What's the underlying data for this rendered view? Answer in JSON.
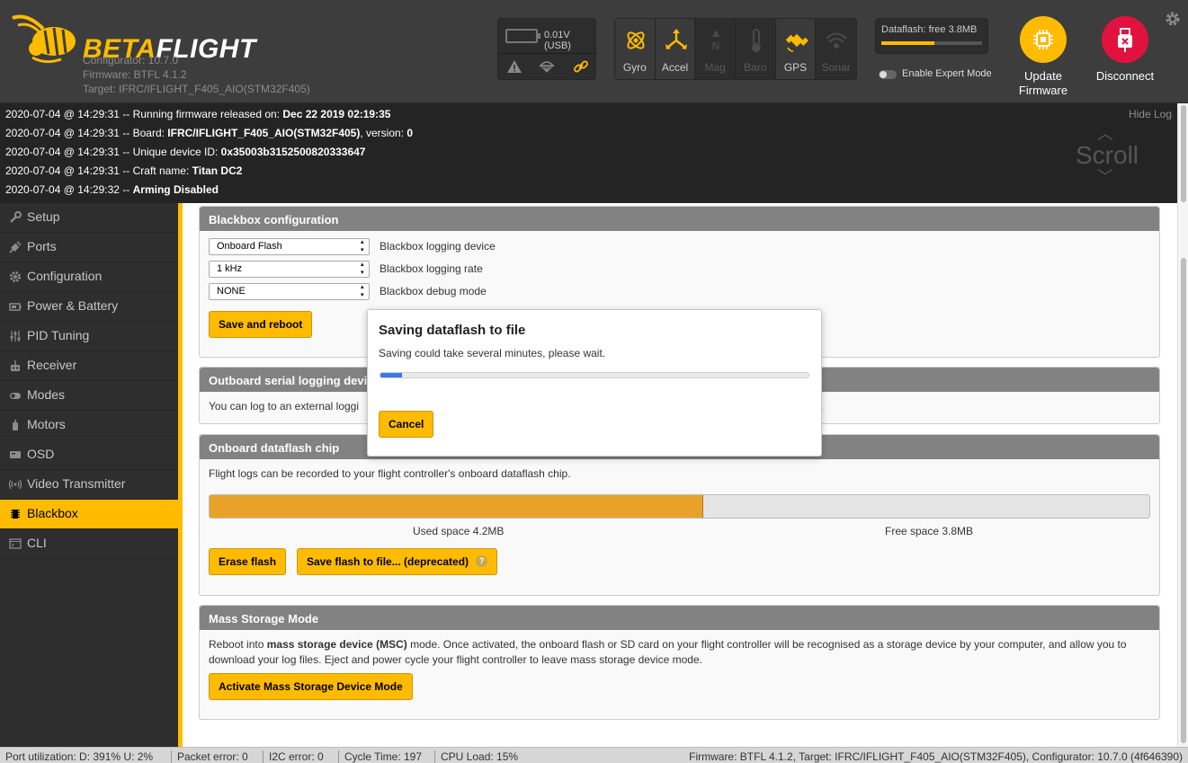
{
  "header": {
    "brand_part1": "BETA",
    "brand_part2": "FLIGHT",
    "configurator": "Configurator: 10.7.0",
    "firmware": "Firmware: BTFL 4.1.2",
    "target": "Target: IFRC/IFLIGHT_F405_AIO(STM32F405)",
    "voltage": "0.01V (USB)",
    "status_icons": [
      "warning-icon",
      "parachute-icon",
      "link-icon"
    ],
    "sensors": [
      {
        "label": "Gyro",
        "icon": "gyro-icon",
        "active": true
      },
      {
        "label": "Accel",
        "icon": "accel-icon",
        "active": true
      },
      {
        "label": "Mag",
        "icon": "mag-icon",
        "active": false
      },
      {
        "label": "Baro",
        "icon": "baro-icon",
        "active": false
      },
      {
        "label": "GPS",
        "icon": "gps-icon",
        "active": true
      },
      {
        "label": "Sonar",
        "icon": "sonar-icon",
        "active": false
      }
    ],
    "dataflash_label": "Dataflash: free 3.8MB",
    "dataflash_used_fraction": 0.53,
    "expert_mode_label": "Enable Expert Mode",
    "expert_mode_on": false,
    "update_firmware_line1": "Update",
    "update_firmware_line2": "Firmware",
    "disconnect_label": "Disconnect",
    "colors": {
      "accent": "#ffbb00",
      "disconnect": "#e2123f",
      "header_bg": "#3d3d3d"
    }
  },
  "log": {
    "hide_label": "Hide Log",
    "scroll_label": "Scroll",
    "lines": [
      {
        "prefix": "2020-07-04 @ 14:29:31 -- Running firmware released on: ",
        "bold": "Dec 22 2019 02:19:35",
        "suffix": ""
      },
      {
        "prefix": "2020-07-04 @ 14:29:31 -- Board: ",
        "bold": "IFRC/IFLIGHT_F405_AIO(STM32F405)",
        "suffix": ", version: ",
        "bold2": "0"
      },
      {
        "prefix": "2020-07-04 @ 14:29:31 -- Unique device ID: ",
        "bold": "0x35003b3152500820333647",
        "suffix": ""
      },
      {
        "prefix": "2020-07-04 @ 14:29:31 -- Craft name: ",
        "bold": "Titan DC2",
        "suffix": ""
      },
      {
        "prefix": "2020-07-04 @ 14:29:32 -- ",
        "bold": "Arming Disabled",
        "suffix": ""
      }
    ]
  },
  "sidebar": {
    "items": [
      {
        "label": "Setup",
        "icon": "wrench-icon",
        "active": false
      },
      {
        "label": "Ports",
        "icon": "plug-icon",
        "active": false
      },
      {
        "label": "Configuration",
        "icon": "gear-icon",
        "active": false
      },
      {
        "label": "Power & Battery",
        "icon": "battery-icon",
        "active": false
      },
      {
        "label": "PID Tuning",
        "icon": "sliders-icon",
        "active": false
      },
      {
        "label": "Receiver",
        "icon": "receiver-icon",
        "active": false
      },
      {
        "label": "Modes",
        "icon": "toggle-icon",
        "active": false
      },
      {
        "label": "Motors",
        "icon": "motor-icon",
        "active": false
      },
      {
        "label": "OSD",
        "icon": "osd-icon",
        "active": false
      },
      {
        "label": "Video Transmitter",
        "icon": "antenna-icon",
        "active": false
      },
      {
        "label": "Blackbox",
        "icon": "blackbox-icon",
        "active": true
      },
      {
        "label": "CLI",
        "icon": "terminal-icon",
        "active": false
      }
    ]
  },
  "blackbox_config": {
    "title": "Blackbox configuration",
    "device_value": "Onboard Flash",
    "device_label": "Blackbox logging device",
    "rate_value": "1 kHz",
    "rate_label": "Blackbox logging rate",
    "debug_value": "NONE",
    "debug_label": "Blackbox debug mode",
    "save_reboot": "Save and reboot"
  },
  "outboard": {
    "title": "Outboard serial logging devi",
    "text": "You can log to an external loggi",
    "text_tail": "."
  },
  "dataflash_chip": {
    "title": "Onboard dataflash chip",
    "text": "Flight logs can be recorded to your flight controller's onboard dataflash chip.",
    "used_fraction": 0.525,
    "used_label": "Used space 4.2MB",
    "free_label": "Free space 3.8MB",
    "erase": "Erase flash",
    "save_file": "Save flash to file... (deprecated)",
    "help": "?"
  },
  "mass_storage": {
    "title": "Mass Storage Mode",
    "text_pre": "Reboot into ",
    "text_bold": "mass storage device (MSC)",
    "text_post": " mode. Once activated, the onboard flash or SD card on your flight controller will be recognised as a storage device by your computer, and allow you to download your log files. Eject and power cycle your flight controller to leave mass storage device mode.",
    "button": "Activate Mass Storage Device Mode"
  },
  "modal": {
    "title": "Saving dataflash to file",
    "message": "Saving could take several minutes, please wait.",
    "progress_fraction": 0.05,
    "cancel": "Cancel"
  },
  "status_bar": {
    "port_util": "Port utilization: D: 391% U: 2%",
    "packet_error": "Packet error: 0",
    "i2c_error": "I2C error: 0",
    "cycle_time": "Cycle Time: 197",
    "cpu_load": "CPU Load: 15%",
    "right": "Firmware: BTFL 4.1.2, Target: IFRC/IFLIGHT_F405_AIO(STM32F405), Configurator: 10.7.0 (4f646390)"
  }
}
